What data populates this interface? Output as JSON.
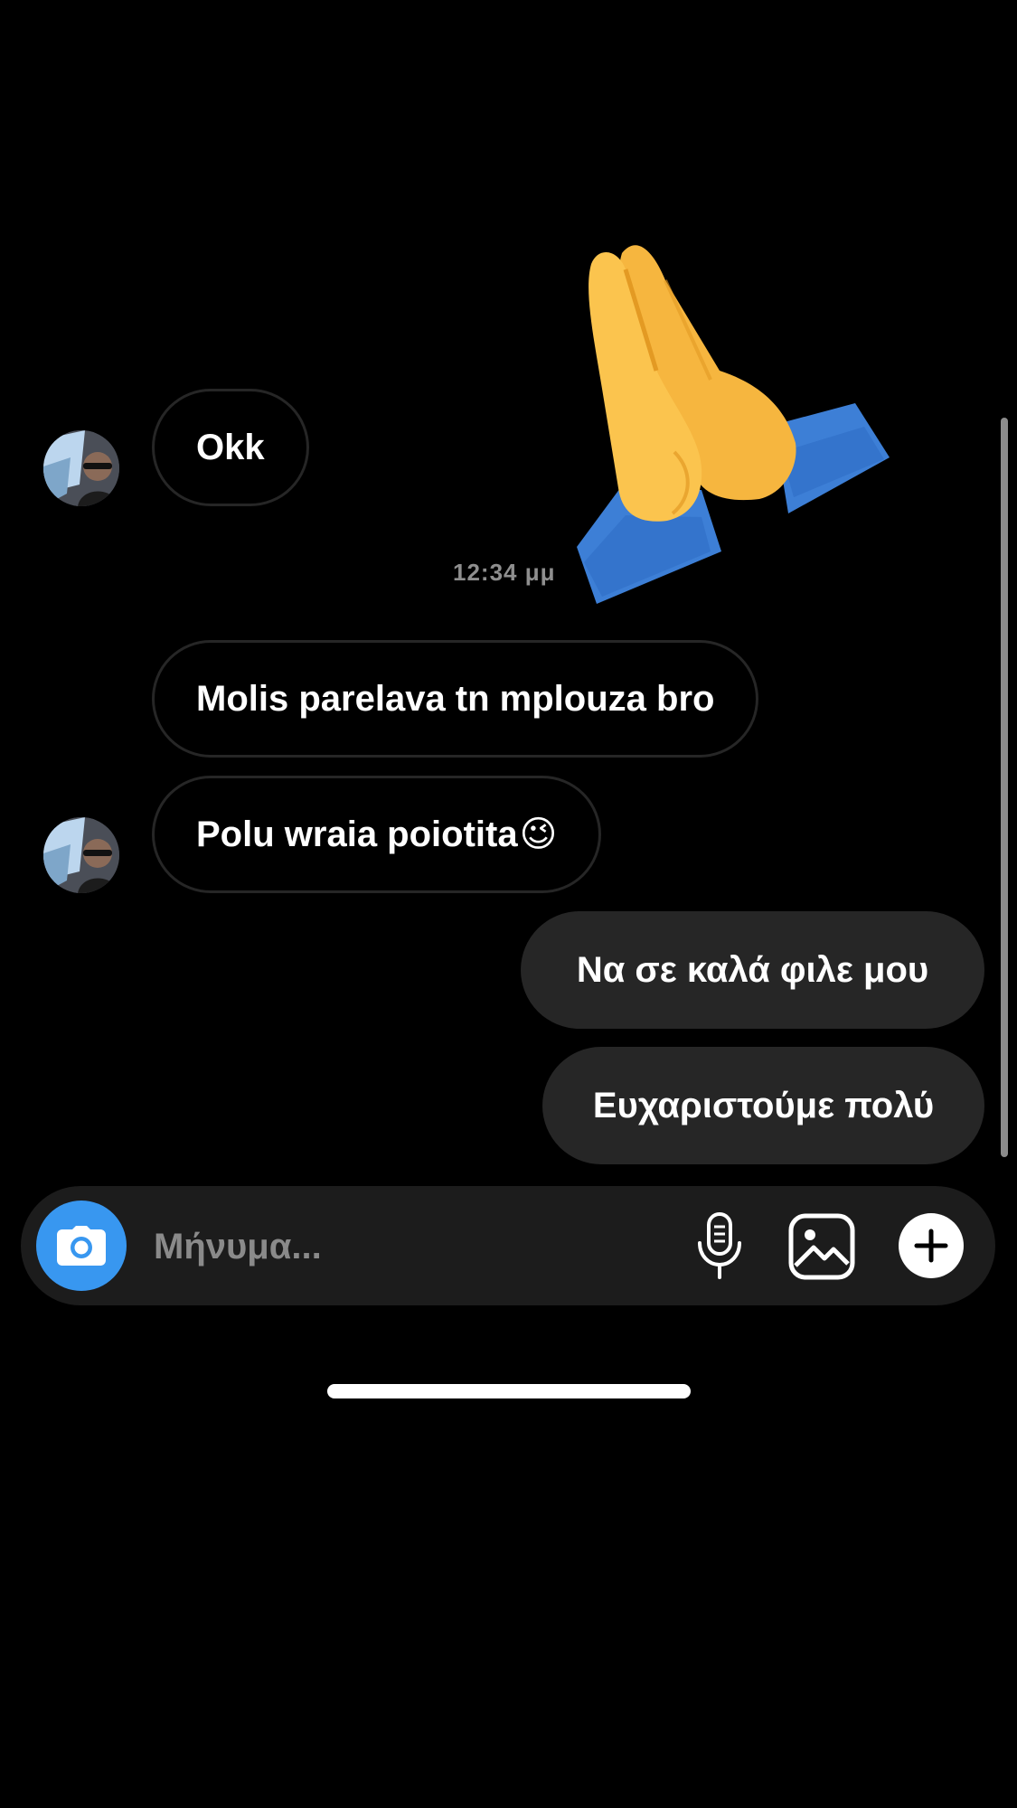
{
  "messages": {
    "first_reply": "Okk",
    "timestamp": "12:34 μμ",
    "line_one": "Molis parelava tn mplouza bro",
    "line_two": "Polu wraia poiotita",
    "line_two_emoji": "😉",
    "sent_one": "Να σε καλά φιλε μου",
    "sent_two": "Ευχαριστούμε πολύ"
  },
  "sticker": {
    "emoji": "🙏",
    "name": "folded-hands"
  },
  "composer": {
    "placeholder": "Μήνυμα..."
  },
  "icons": {
    "camera": "camera-icon",
    "microphone": "microphone-icon",
    "gallery": "gallery-icon",
    "plus": "plus-icon"
  },
  "colors": {
    "background": "#000000",
    "incoming_border": "#262626",
    "outgoing_bubble": "#262626",
    "composer": "#1c1c1c",
    "camera_button": "#3897f0",
    "timestamp": "#8e8e8e",
    "placeholder": "#8a8a8a"
  }
}
